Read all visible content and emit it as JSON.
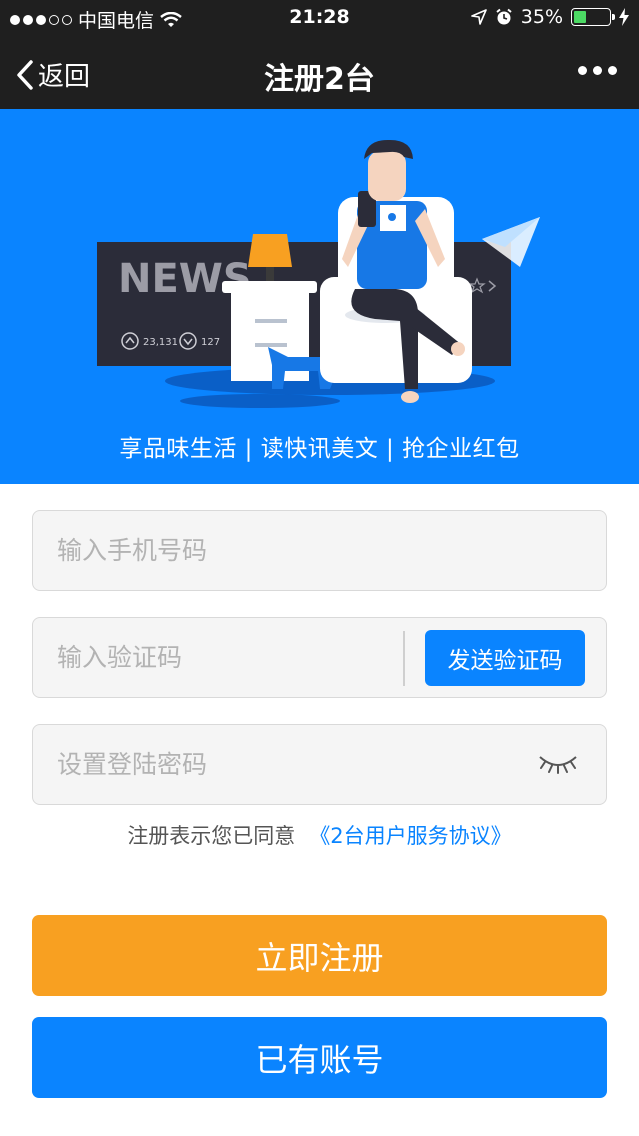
{
  "status_bar": {
    "carrier": "中国电信",
    "time": "21:28",
    "battery": "35%",
    "battery_level": 0.35
  },
  "nav": {
    "back_label": "返回",
    "title": "注册2台"
  },
  "banner": {
    "news_text": "NEWS",
    "upvotes": "23,131",
    "downvotes": "127",
    "slogan": "享品味生活 | 读快讯美文 | 抢企业红包"
  },
  "form": {
    "phone_placeholder": "输入手机号码",
    "code_placeholder": "输入验证码",
    "send_code_label": "发送验证码",
    "password_placeholder": "设置登陆密码",
    "agreement_text": "注册表示您已同意",
    "agreement_link": "《2台用户服务协议》"
  },
  "buttons": {
    "register_label": "立即注册",
    "login_label": "已有账号"
  },
  "colors": {
    "primary_blue": "#0a84ff",
    "register_orange": "#f8a021",
    "bar_dark": "#1f1f1f"
  }
}
